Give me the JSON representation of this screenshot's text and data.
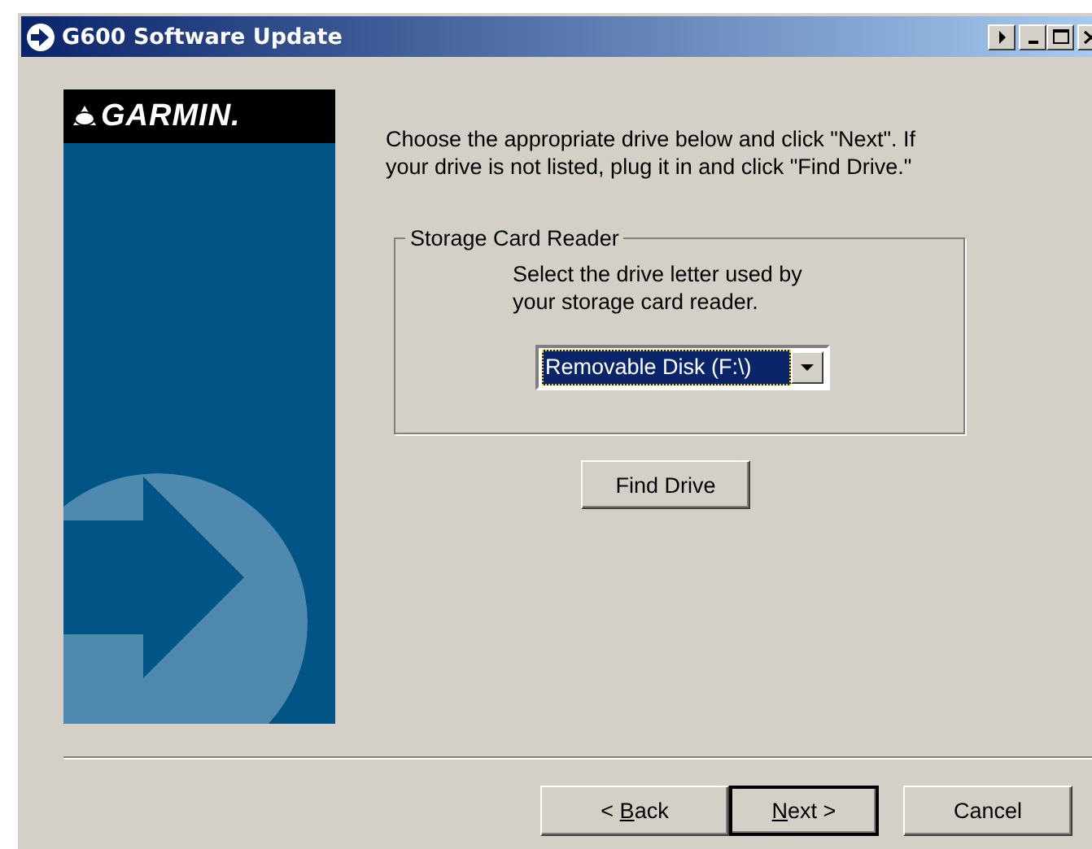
{
  "window": {
    "title": "G600 Software Update"
  },
  "banner": {
    "logo": "GARMIN."
  },
  "instructions": "Choose the appropriate drive below and click \"Next\". If your drive is not listed, plug it in and click \"Find Drive.\"",
  "group": {
    "title": "Storage Card Reader",
    "prompt": "Select the drive letter used by your storage card reader.",
    "dropdown": {
      "value": "Removable Disk (F:\\)",
      "focused": true
    }
  },
  "find_button": "Find Drive",
  "buttons": [
    {
      "prefix": "< ",
      "key": "B",
      "rest": "ack",
      "default": false
    },
    {
      "key": "N",
      "rest": "ext >",
      "default": true
    },
    {
      "rest": "Cancel",
      "default": false
    }
  ]
}
